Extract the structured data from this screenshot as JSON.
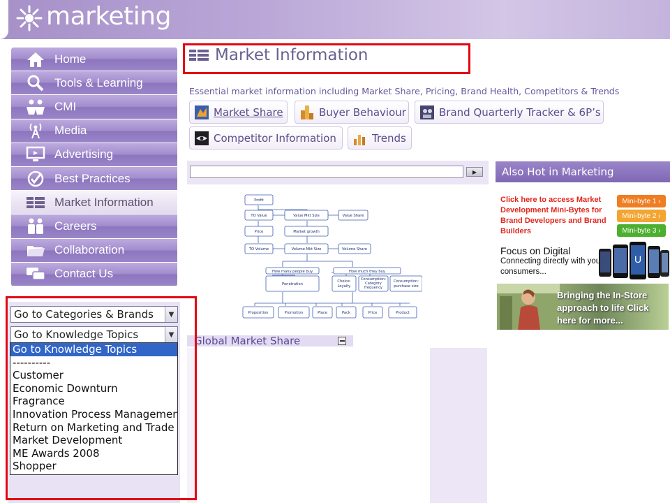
{
  "brand": {
    "name": "marketing"
  },
  "nav": {
    "items": [
      {
        "label": "Home",
        "icon": "home-icon"
      },
      {
        "label": "Tools & Learning",
        "icon": "magnifier-icon"
      },
      {
        "label": "CMI",
        "icon": "people-icon"
      },
      {
        "label": "Media",
        "icon": "broadcast-tower-icon"
      },
      {
        "label": "Advertising",
        "icon": "monitor-icon"
      },
      {
        "label": "Best Practices",
        "icon": "check-badge-icon"
      },
      {
        "label": "Market Information",
        "icon": "stack-icon",
        "active": true
      },
      {
        "label": "Careers",
        "icon": "people-pair-icon"
      },
      {
        "label": "Collaboration",
        "icon": "folder-icon"
      },
      {
        "label": "Contact Us",
        "icon": "chat-icon"
      }
    ]
  },
  "left_panel": {
    "categories_select": "Go to Categories & Brands",
    "topics_select": "Go to Knowledge Topics",
    "topics_options": [
      "Go to Knowledge Topics",
      "----------",
      "Customer",
      "Economic Downturn",
      "Fragrance",
      "Innovation Process Management",
      "Return on Marketing and Trade",
      "Market Development",
      "ME Awards 2008",
      "Shopper"
    ]
  },
  "main": {
    "title": "Market Information",
    "intro": "Essential market information including Market Share, Pricing, Brand Health, Competitors & Trends",
    "tabs": [
      {
        "label": "Market Share",
        "icon": "market-share-icon"
      },
      {
        "label": "Buyer Behaviour",
        "icon": "buyer-behaviour-icon"
      },
      {
        "label": "Brand Quarterly Tracker & 6P’s",
        "icon": "brand-tracker-icon"
      },
      {
        "label": "Competitor Information",
        "icon": "competitor-icon"
      },
      {
        "label": "Trends",
        "icon": "trends-icon"
      }
    ],
    "diagram": {
      "nodes": {
        "profit": "Profit",
        "to_value": "TO Value",
        "value_mkt_size": "Value Mkt Size",
        "value_share": "Value Share",
        "price": "Price",
        "market_growth": "Market growth",
        "to_volume": "TO Volume",
        "volume_mkt_size": "Volume Mkt Size",
        "volume_share": "Volume Share",
        "how_many": "How many people buy",
        "how_much": "How much they buy",
        "penetration": "Penetration",
        "choice_1": "Choice:",
        "choice_2": "Loyalty",
        "consumption_freq_1": "Consumption:",
        "consumption_freq_2": "Category",
        "consumption_freq_3": "frequency",
        "consumption_size_1": "Consumption:",
        "consumption_size_2": "purchase size",
        "proposition": "Proposition",
        "promotion": "Promotion",
        "place": "Place",
        "pack": "Pack",
        "price_b": "Price",
        "product": "Product"
      }
    },
    "global_market_share": "Global Market Share"
  },
  "right": {
    "header": "Also Hot in Marketing",
    "promo1": {
      "text": "Click here to access Market Development Mini-Bytes for Brand Developers and Brand Builders",
      "buttons": [
        "Mini-byte 1",
        "Mini-byte 2",
        "Mini-byte 3"
      ],
      "button_colors": [
        "#ef7d22",
        "#f3a531",
        "#4caf2e"
      ]
    },
    "promo2": {
      "title": "Focus on Digital",
      "subtitle": "Connecting directly with your consumers..."
    },
    "promo3": {
      "text": "Bringing the In-Store approach to life Click here for more..."
    }
  },
  "colors": {
    "highlight": "#e30613",
    "brand_purple": "#9b86c2"
  }
}
